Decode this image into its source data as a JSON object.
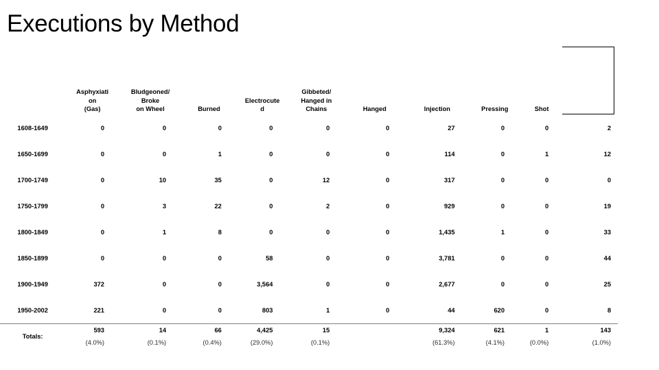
{
  "slide": {
    "title": "Executions by Method"
  },
  "table": {
    "row_header_label": "",
    "columns": [
      {
        "label": "Asphyxiati\non\n(Gas)",
        "lines": [
          "Asphyxiati",
          "on",
          "(Gas)"
        ],
        "key": "asphyxiation_gas"
      },
      {
        "label": "Bludgeoned/\nBroke\non Wheel",
        "lines": [
          "Bludgeoned/",
          "Broke",
          "on Wheel"
        ],
        "key": "bludgeoned_broke_on_wheel"
      },
      {
        "label": "Burned",
        "lines": [
          "Burned"
        ],
        "key": "burned"
      },
      {
        "label": "Electrocute\nd",
        "lines": [
          "Electrocute",
          "d"
        ],
        "key": "electrocuted"
      },
      {
        "label": "Gibbeted/\nHanged in\nChains",
        "lines": [
          "Gibbeted/",
          "Hanged in",
          "Chains"
        ],
        "key": "gibbeted_hanged_in_chains"
      },
      {
        "label": "Hanged",
        "lines": [
          "Hanged"
        ],
        "key": "hanged"
      },
      {
        "label": "Injection",
        "lines": [
          "Injection"
        ],
        "key": "injection"
      },
      {
        "label": "Pressing",
        "lines": [
          "Pressing"
        ],
        "key": "pressing"
      },
      {
        "label": "Shot",
        "lines": [
          "Shot"
        ],
        "key": "shot"
      },
      {
        "label": "",
        "lines": [
          ""
        ],
        "key": "unlabeled"
      }
    ],
    "rows": [
      {
        "period": "1608-1649",
        "values": [
          "0",
          "0",
          "0",
          "0",
          "0",
          "0",
          "27",
          "0",
          "0",
          "2"
        ]
      },
      {
        "period": "1650-1699",
        "values": [
          "0",
          "0",
          "1",
          "0",
          "0",
          "0",
          "114",
          "0",
          "1",
          "12"
        ]
      },
      {
        "period": "1700-1749",
        "values": [
          "0",
          "10",
          "35",
          "0",
          "12",
          "0",
          "317",
          "0",
          "0",
          "0"
        ]
      },
      {
        "period": "1750-1799",
        "values": [
          "0",
          "3",
          "22",
          "0",
          "2",
          "0",
          "929",
          "0",
          "0",
          "19"
        ]
      },
      {
        "period": "1800-1849",
        "values": [
          "0",
          "1",
          "8",
          "0",
          "0",
          "0",
          "1,435",
          "1",
          "0",
          "33"
        ]
      },
      {
        "period": "1850-1899",
        "values": [
          "0",
          "0",
          "0",
          "58",
          "0",
          "0",
          "3,781",
          "0",
          "0",
          "44"
        ]
      },
      {
        "period": "1900-1949",
        "values": [
          "372",
          "0",
          "0",
          "3,564",
          "0",
          "0",
          "2,677",
          "0",
          "0",
          "25"
        ]
      },
      {
        "period": "1950-2002",
        "values": [
          "221",
          "0",
          "0",
          "803",
          "1",
          "0",
          "44",
          "620",
          "0",
          "8"
        ]
      }
    ],
    "totals": {
      "label": "Totals:",
      "values": [
        "593",
        "14",
        "66",
        "4,425",
        "15",
        "",
        "9,324",
        "621",
        "1",
        "143"
      ],
      "percents": [
        "(4.0%)",
        "(0.1%)",
        "(0.4%)",
        "(29.0%)",
        "(0.1%)",
        "",
        "(61.3%)",
        "(4.1%)",
        "(0.0%)",
        "(1.0%)"
      ]
    }
  },
  "colors": {
    "text": "#000000",
    "rule": "#808080",
    "border": "#000000",
    "background": "#ffffff"
  }
}
